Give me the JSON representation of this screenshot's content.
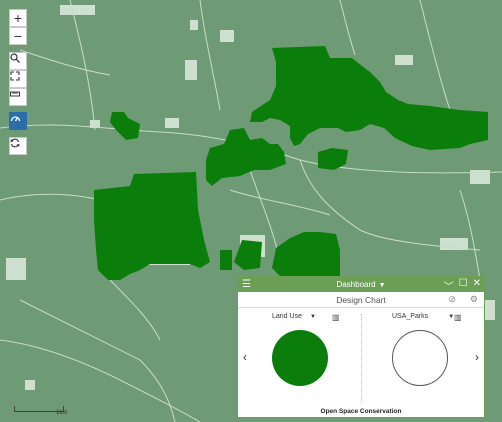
{
  "map": {
    "zoom_in_label": "+",
    "zoom_out_label": "−",
    "scale_label": "1km"
  },
  "dashboard": {
    "title": "Dashboard",
    "chart_title": "Design Chart",
    "left_select": "Land Use",
    "right_select": "USA_Parks",
    "footer_label": "Open Space Conservation",
    "left_circle_color": "#0a7d0a",
    "header_color": "#6b9f55"
  }
}
